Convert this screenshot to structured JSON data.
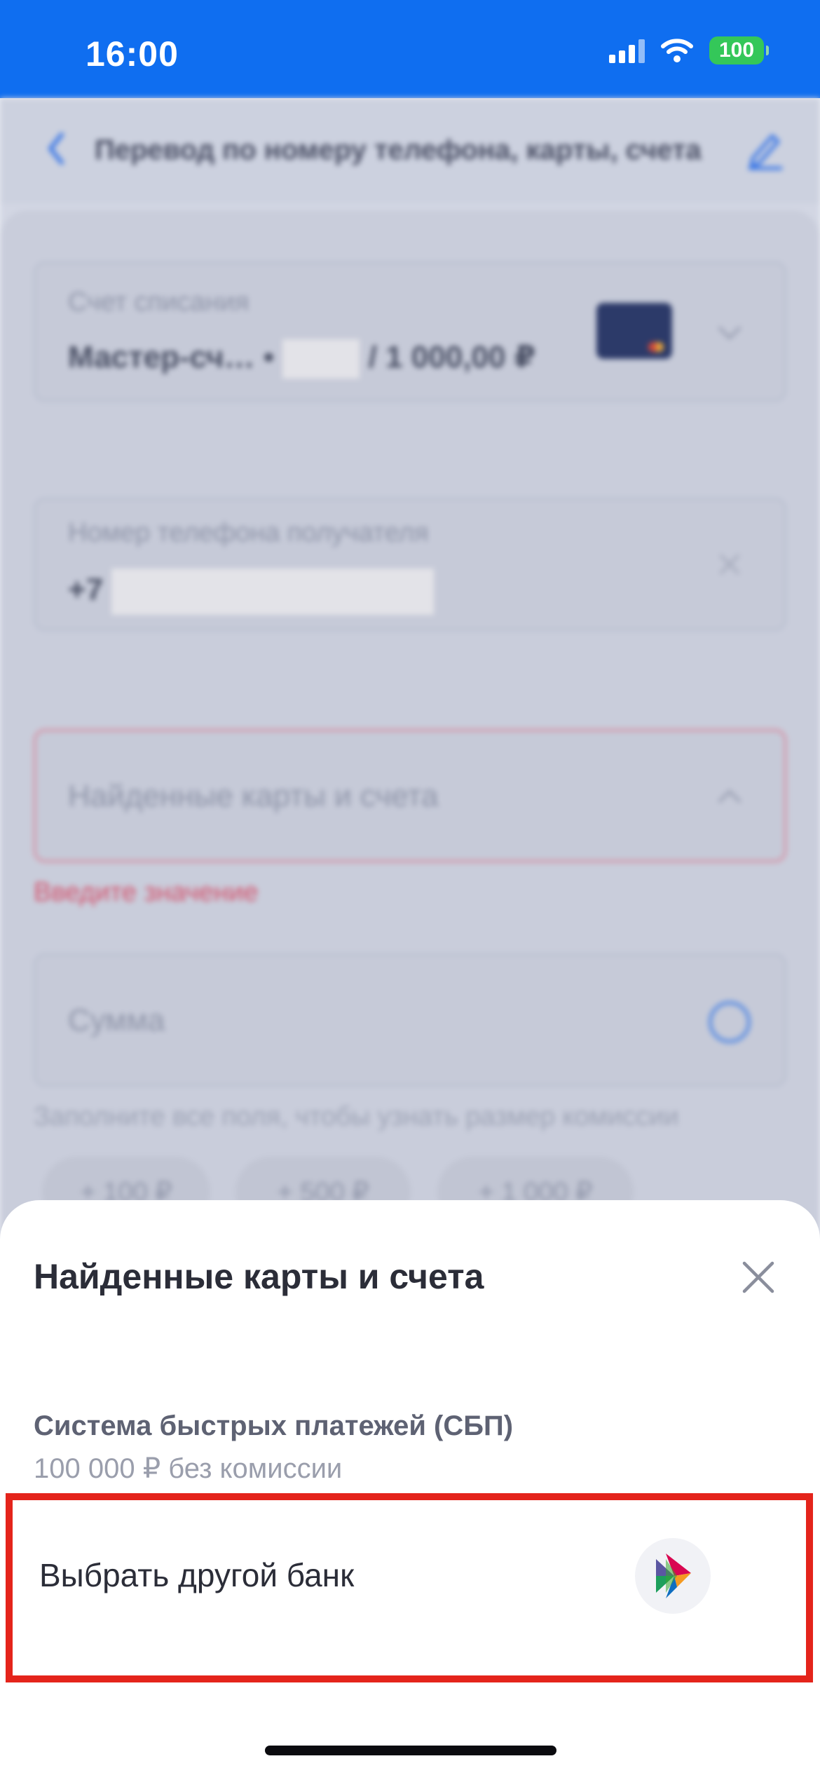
{
  "status_bar": {
    "time": "16:00",
    "battery": "100"
  },
  "header": {
    "title": "Перевод по номеру телефона, карты, счета"
  },
  "form": {
    "debit_account": {
      "label": "Счет списания",
      "value_prefix": "Мастер-сч… •",
      "value_suffix": "/ 1 000,00 ₽"
    },
    "phone": {
      "label": "Номер телефона получателя",
      "prefix": "+7"
    },
    "found_cards": {
      "placeholder": "Найденные карты и счета",
      "error": "Введите значение"
    },
    "amount": {
      "placeholder": "Сумма",
      "hint": "Заполните все поля, чтобы узнать размер комиссии"
    },
    "quick_amounts": [
      "+ 100 ₽",
      "+ 500 ₽",
      "+ 1 000 ₽"
    ]
  },
  "sheet": {
    "title": "Найденные карты и счета",
    "sbp_title": "Система быстрых платежей (СБП)",
    "sbp_subtitle": "100 000 ₽ без комиссии",
    "choose_bank": "Выбрать другой банк"
  },
  "colors": {
    "status_bar": "#0f6ef0",
    "highlight": "#e4241b",
    "error": "#d4506a"
  }
}
